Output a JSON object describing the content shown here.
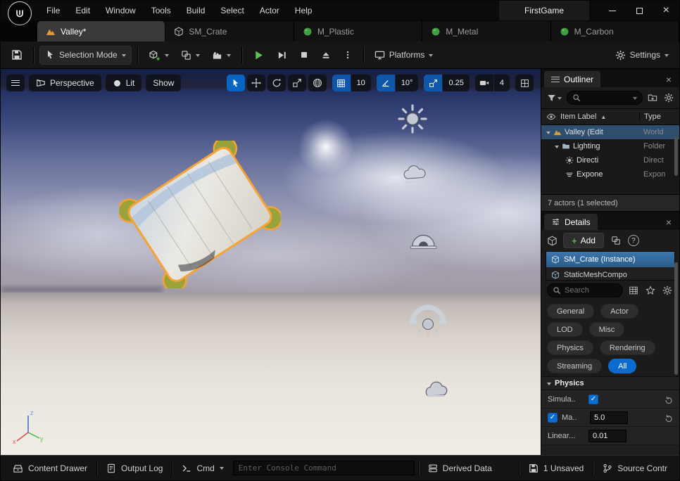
{
  "titlebar": {
    "project": "FirstGame",
    "menus": [
      "File",
      "Edit",
      "Window",
      "Tools",
      "Build",
      "Select",
      "Actor",
      "Help"
    ]
  },
  "tabs": [
    {
      "label": "Valley*"
    },
    {
      "label": "SM_Crate"
    },
    {
      "label": "M_Plastic"
    },
    {
      "label": "M_Metal"
    },
    {
      "label": "M_Carbon"
    }
  ],
  "toolbar": {
    "selection_mode": "Selection Mode",
    "platforms": "Platforms",
    "settings": "Settings"
  },
  "viewport": {
    "perspective": "Perspective",
    "lit": "Lit",
    "show": "Show",
    "grid_snap": "10",
    "angle_snap": "10°",
    "scale_snap": "0.25",
    "camera_speed": "4",
    "axis": {
      "x": "x",
      "y": "y",
      "z": "z"
    }
  },
  "outliner": {
    "title": "Outliner",
    "columns": {
      "item_label": "Item Label",
      "sort": "▲",
      "type": "Type"
    },
    "rows": [
      {
        "label": "Valley (Edit",
        "type": "World"
      },
      {
        "label": "Lighting",
        "type": "Folder"
      },
      {
        "label": "Directi",
        "type": "Direct"
      },
      {
        "label": "Expone",
        "type": "Expon"
      }
    ],
    "status": "7 actors (1 selected)"
  },
  "details": {
    "title": "Details",
    "add": "Add",
    "component": "SM_Crate (Instance)",
    "subcomponent": "StaticMeshCompo",
    "search_placeholder": "Search",
    "filters": [
      "General",
      "Actor",
      "LOD",
      "Misc",
      "Physics",
      "Rendering",
      "Streaming",
      "All"
    ],
    "section": "Physics",
    "props": [
      {
        "label": "Simula.."
      },
      {
        "label": "Ma..",
        "value": "5.0"
      },
      {
        "label": "Linear...",
        "value": "0.01"
      }
    ]
  },
  "statusbar": {
    "content_drawer": "Content Drawer",
    "output_log": "Output Log",
    "cmd": "Cmd",
    "console_placeholder": "Enter Console Command",
    "derived_data": "Derived Data",
    "unsaved": "1 Unsaved",
    "source_control": "Source Contr"
  },
  "colors": {
    "accent_blue": "#0a6cce",
    "selection_orange": "#f6a234",
    "play_green": "#58c458",
    "checkbox_blue": "#0a6cce"
  }
}
